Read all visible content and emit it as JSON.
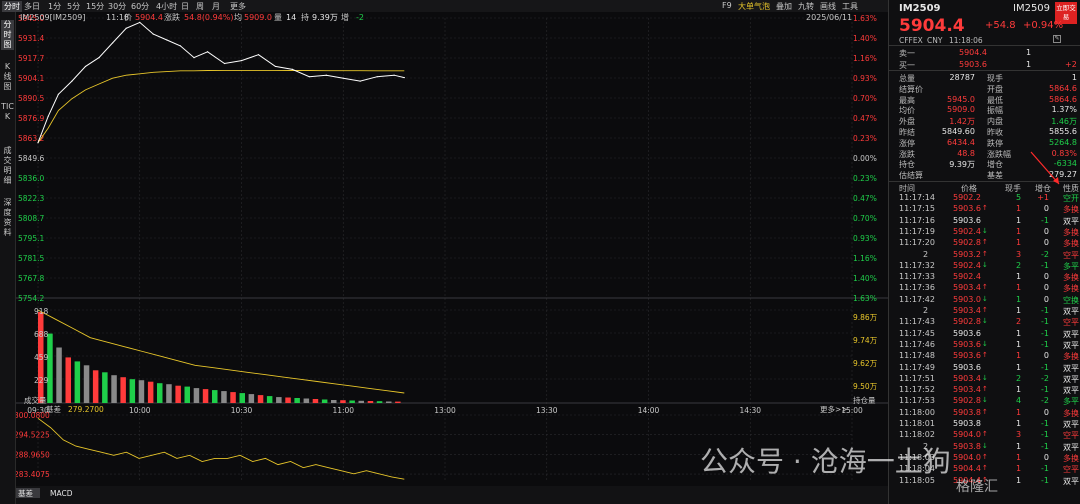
{
  "toolbar": {
    "tabs": [
      "分时",
      "多日",
      "1分",
      "5分",
      "15分",
      "30分",
      "60分",
      "4小时",
      "日",
      "周",
      "月",
      "更多"
    ],
    "right": [
      "F9",
      "大单气泡",
      "叠加",
      "九转",
      "画线",
      "工具"
    ],
    "active_tab": "分时"
  },
  "side_tabs": [
    "分时图",
    "K线图",
    "TICK",
    "成交明细",
    "深度资料"
  ],
  "info_bar": {
    "code": "IM2509[IM2509]",
    "time": "11:18",
    "price_label": "价",
    "price": "5904.4",
    "change_label": "涨跌",
    "change": "54.8(0.94%)",
    "avg_label": "均",
    "avg": "5909.0",
    "vol_label": "量",
    "vol": "14",
    "oi_label": "持",
    "oi": "9.39万",
    "inc_label": "增",
    "inc": "-2",
    "date": "2025/06/11"
  },
  "price_axis": {
    "left": [
      "5945.0",
      "5931.4",
      "5917.7",
      "5904.1",
      "5890.5",
      "5876.9",
      "5863.2",
      "5849.6",
      "5836.0",
      "5822.3",
      "5808.7",
      "5795.1",
      "5781.5",
      "5767.8",
      "5754.2"
    ],
    "right": [
      "1.63%",
      "1.40%",
      "1.16%",
      "0.93%",
      "0.70%",
      "0.47%",
      "0.23%",
      "0.00%",
      "0.23%",
      "0.47%",
      "0.70%",
      "0.93%",
      "1.16%",
      "1.40%",
      "1.63%"
    ]
  },
  "volume_axis": {
    "left": [
      "918",
      "688",
      "459",
      "229"
    ],
    "left_title": "成交量",
    "right": [
      "9.86万",
      "9.74万",
      "9.62万",
      "9.50万"
    ],
    "right_title": "持仓量"
  },
  "time_axis": [
    "09:30",
    "10:00",
    "10:30",
    "11:00",
    "13:00",
    "13:30",
    "14:00",
    "14:30",
    "15:00"
  ],
  "basis": {
    "label": "基差",
    "value": "279.2700",
    "axis": [
      "300.0800",
      "294.5225",
      "288.9650",
      "283.4075"
    ],
    "more": "更多>>"
  },
  "bottom_tabs": [
    "基差",
    "MACD"
  ],
  "chart_data": {
    "type": "line",
    "price_series": {
      "time": [
        "09:30",
        "09:33",
        "09:36",
        "09:40",
        "09:44",
        "09:48",
        "09:52",
        "09:56",
        "10:00",
        "10:04",
        "10:08",
        "10:12",
        "10:16",
        "10:20",
        "10:25",
        "10:30",
        "10:35",
        "10:40",
        "10:45",
        "10:50",
        "10:55",
        "11:00",
        "11:05",
        "11:10",
        "11:15",
        "11:18"
      ],
      "price": [
        5860,
        5878,
        5893,
        5902,
        5912,
        5918,
        5928,
        5938,
        5942,
        5934,
        5930,
        5926,
        5918,
        5922,
        5914,
        5916,
        5920,
        5912,
        5910,
        5905,
        5906,
        5904,
        5902,
        5905,
        5906,
        5904.4
      ],
      "avg": [
        5860,
        5870,
        5882,
        5890,
        5896,
        5900,
        5904,
        5906,
        5907,
        5908,
        5908.5,
        5909,
        5909,
        5909.2,
        5909.3,
        5909.3,
        5909.3,
        5909.3,
        5909.2,
        5909.2,
        5909.1,
        5909.1,
        5909.1,
        5909.0,
        5909.0,
        5909.0
      ]
    },
    "ylim": [
      5754.2,
      5945.0
    ],
    "volume_heights": [
      918,
      700,
      560,
      460,
      420,
      380,
      330,
      310,
      280,
      260,
      240,
      230,
      215,
      200,
      190,
      175,
      165,
      150,
      140,
      130,
      120,
      110,
      100,
      90,
      80,
      70,
      60,
      55,
      50,
      45,
      40,
      35,
      30,
      28,
      25,
      22,
      20,
      18,
      15,
      14
    ],
    "open_interest": [
      9.86,
      9.82,
      9.78,
      9.74,
      9.72,
      9.7,
      9.68,
      9.66,
      9.64,
      9.62,
      9.61,
      9.6,
      9.59,
      9.58,
      9.57,
      9.56,
      9.55,
      9.54,
      9.53,
      9.52,
      9.51,
      9.5
    ],
    "basis_values": [
      299,
      296,
      292,
      290,
      289,
      288,
      287,
      288,
      286,
      287,
      288,
      286,
      287,
      285,
      286,
      286,
      287,
      285,
      286,
      284,
      285,
      283,
      284,
      283,
      282,
      281,
      282,
      281,
      280,
      279.27
    ]
  },
  "right_panel": {
    "code": "IM2509",
    "name": "IM2509",
    "badge": "立即交易",
    "price": "5904.4",
    "change": "+54.8",
    "change_pct": "+0.94%",
    "exchange": "CFFEX",
    "currency": "CNY",
    "time": "11:18:06",
    "sell1_label": "卖一",
    "sell1_price": "5904.4",
    "sell1_vol": "1",
    "buy1_label": "买一",
    "buy1_price": "5903.6",
    "buy1_vol": "1",
    "buy1_chg": "+2",
    "stats": [
      {
        "l1": "总量",
        "v1": "28787",
        "c1": "white",
        "l2": "现手",
        "v2": "1",
        "c2": "white"
      },
      {
        "l1": "结算价",
        "v1": "",
        "c1": "white",
        "l2": "开盘",
        "v2": "5864.6",
        "c2": "red"
      },
      {
        "l1": "最高",
        "v1": "5945.0",
        "c1": "red",
        "l2": "最低",
        "v2": "5864.6",
        "c2": "red"
      },
      {
        "l1": "均价",
        "v1": "5909.0",
        "c1": "red",
        "l2": "振幅",
        "v2": "1.37%",
        "c2": "white"
      },
      {
        "l1": "外盘",
        "v1": "1.42万",
        "c1": "red",
        "l2": "内盘",
        "v2": "1.46万",
        "c2": "green"
      },
      {
        "l1": "昨结",
        "v1": "5849.60",
        "c1": "white",
        "l2": "昨收",
        "v2": "5855.6",
        "c2": "white"
      },
      {
        "l1": "涨停",
        "v1": "6434.4",
        "c1": "red",
        "l2": "跌停",
        "v2": "5264.8",
        "c2": "green"
      },
      {
        "l1": "涨跌",
        "v1": "48.8",
        "c1": "red",
        "l2": "涨跌幅",
        "v2": "0.83%",
        "c2": "red"
      },
      {
        "l1": "持仓",
        "v1": "9.39万",
        "c1": "white",
        "l2": "增仓",
        "v2": "-6334",
        "c2": "green"
      },
      {
        "l1": "估结算",
        "v1": "",
        "c1": "white",
        "l2": "基差",
        "v2": "279.27",
        "c2": "white"
      }
    ],
    "trade_headers": [
      "时间",
      "价格",
      "现手",
      "增仓",
      "性质"
    ],
    "trades": [
      {
        "t": "11:17:14",
        "p": "5902.2",
        "pc": "red",
        "a": "",
        "v": "5",
        "vc": "green",
        "i": "+1",
        "ic": "red",
        "n": "空开",
        "nc": "green"
      },
      {
        "t": "11:17:15",
        "p": "5903.6",
        "pc": "red",
        "a": "up",
        "v": "1",
        "vc": "red",
        "i": "0",
        "ic": "white",
        "n": "多换",
        "nc": "red"
      },
      {
        "t": "11:17:16",
        "p": "5903.6",
        "pc": "white",
        "a": "",
        "v": "1",
        "vc": "white",
        "i": "-1",
        "ic": "green",
        "n": "双平",
        "nc": "white"
      },
      {
        "t": "11:17:19",
        "p": "5902.4",
        "pc": "red",
        "a": "down",
        "v": "1",
        "vc": "red",
        "i": "0",
        "ic": "white",
        "n": "多换",
        "nc": "red"
      },
      {
        "t": "11:17:20",
        "p": "5902.8",
        "pc": "red",
        "a": "up",
        "v": "1",
        "vc": "red",
        "i": "0",
        "ic": "white",
        "n": "多换",
        "nc": "red"
      },
      {
        "t": "2",
        "p": "5903.2",
        "pc": "red",
        "a": "up",
        "v": "3",
        "vc": "red",
        "i": "-2",
        "ic": "green",
        "n": "空平",
        "nc": "red"
      },
      {
        "t": "11:17:32",
        "p": "5902.4",
        "pc": "red",
        "a": "down",
        "v": "2",
        "vc": "green",
        "i": "-1",
        "ic": "green",
        "n": "多平",
        "nc": "green"
      },
      {
        "t": "11:17:33",
        "p": "5902.4",
        "pc": "red",
        "a": "",
        "v": "1",
        "vc": "white",
        "i": "0",
        "ic": "white",
        "n": "多换",
        "nc": "red"
      },
      {
        "t": "11:17:36",
        "p": "5903.4",
        "pc": "red",
        "a": "up",
        "v": "1",
        "vc": "red",
        "i": "0",
        "ic": "white",
        "n": "多换",
        "nc": "red"
      },
      {
        "t": "11:17:42",
        "p": "5903.0",
        "pc": "red",
        "a": "down",
        "v": "1",
        "vc": "green",
        "i": "0",
        "ic": "white",
        "n": "空换",
        "nc": "green"
      },
      {
        "t": "2",
        "p": "5903.4",
        "pc": "red",
        "a": "up",
        "v": "1",
        "vc": "white",
        "i": "-1",
        "ic": "green",
        "n": "双平",
        "nc": "white"
      },
      {
        "t": "11:17:43",
        "p": "5902.8",
        "pc": "red",
        "a": "down",
        "v": "2",
        "vc": "red",
        "i": "-1",
        "ic": "green",
        "n": "空平",
        "nc": "red"
      },
      {
        "t": "11:17:45",
        "p": "5903.6",
        "pc": "white",
        "a": "",
        "v": "1",
        "vc": "white",
        "i": "-1",
        "ic": "green",
        "n": "双平",
        "nc": "white"
      },
      {
        "t": "11:17:46",
        "p": "5903.6",
        "pc": "red",
        "a": "down",
        "v": "1",
        "vc": "white",
        "i": "-1",
        "ic": "green",
        "n": "双平",
        "nc": "white"
      },
      {
        "t": "11:17:48",
        "p": "5903.6",
        "pc": "red",
        "a": "up",
        "v": "1",
        "vc": "red",
        "i": "0",
        "ic": "white",
        "n": "多换",
        "nc": "red"
      },
      {
        "t": "11:17:49",
        "p": "5903.6",
        "pc": "white",
        "a": "",
        "v": "1",
        "vc": "white",
        "i": "-1",
        "ic": "green",
        "n": "双平",
        "nc": "white"
      },
      {
        "t": "11:17:51",
        "p": "5903.4",
        "pc": "red",
        "a": "down",
        "v": "2",
        "vc": "green",
        "i": "-2",
        "ic": "green",
        "n": "双平",
        "nc": "white"
      },
      {
        "t": "11:17:52",
        "p": "5903.4",
        "pc": "red",
        "a": "up",
        "v": "1",
        "vc": "white",
        "i": "-1",
        "ic": "green",
        "n": "双平",
        "nc": "white"
      },
      {
        "t": "11:17:53",
        "p": "5902.8",
        "pc": "red",
        "a": "down",
        "v": "4",
        "vc": "green",
        "i": "-2",
        "ic": "green",
        "n": "多平",
        "nc": "green"
      },
      {
        "t": "11:18:00",
        "p": "5903.8",
        "pc": "red",
        "a": "up",
        "v": "1",
        "vc": "red",
        "i": "0",
        "ic": "white",
        "n": "多换",
        "nc": "red"
      },
      {
        "t": "11:18:01",
        "p": "5903.8",
        "pc": "white",
        "a": "",
        "v": "1",
        "vc": "white",
        "i": "-1",
        "ic": "green",
        "n": "双平",
        "nc": "white"
      },
      {
        "t": "11:18:02",
        "p": "5904.0",
        "pc": "red",
        "a": "up",
        "v": "3",
        "vc": "red",
        "i": "-1",
        "ic": "green",
        "n": "空平",
        "nc": "red"
      },
      {
        "t": "2",
        "p": "5903.8",
        "pc": "red",
        "a": "down",
        "v": "1",
        "vc": "white",
        "i": "-1",
        "ic": "green",
        "n": "双平",
        "nc": "white"
      },
      {
        "t": "11:18:03",
        "p": "5904.0",
        "pc": "red",
        "a": "up",
        "v": "1",
        "vc": "red",
        "i": "0",
        "ic": "white",
        "n": "多换",
        "nc": "red"
      },
      {
        "t": "11:18:04",
        "p": "5904.4",
        "pc": "red",
        "a": "up",
        "v": "1",
        "vc": "red",
        "i": "-1",
        "ic": "green",
        "n": "空平",
        "nc": "red"
      },
      {
        "t": "11:18:05",
        "p": "5904.4",
        "pc": "red",
        "a": "up",
        "v": "1",
        "vc": "white",
        "i": "-1",
        "ic": "green",
        "n": "双平",
        "nc": "white"
      }
    ]
  },
  "watermark": {
    "text": "公众号 · 沧海一土狗",
    "logo": "格隆汇"
  },
  "colors": {
    "up": "#ff3b3b",
    "down": "#1fcf4a",
    "price_line": "#ffffff",
    "avg_line": "#e8c62a",
    "background": "#0b0b0d"
  }
}
